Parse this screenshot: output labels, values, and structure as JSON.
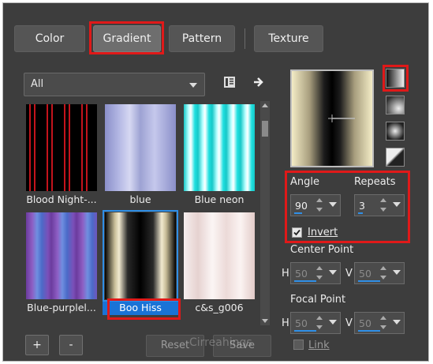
{
  "tabs": [
    {
      "label": "Color"
    },
    {
      "label": "Gradient"
    },
    {
      "label": "Pattern"
    },
    {
      "label": "Texture"
    }
  ],
  "filter": {
    "selected": "All"
  },
  "gradients": [
    {
      "label": "Blood Night-..."
    },
    {
      "label": "blue"
    },
    {
      "label": "Blue neon"
    },
    {
      "label": "Blue-purplel..."
    },
    {
      "label": "Boo Hiss"
    },
    {
      "label": "c&s_g006"
    }
  ],
  "angle": {
    "label": "Angle",
    "value": "90"
  },
  "repeats": {
    "label": "Repeats",
    "value": "3"
  },
  "invert": {
    "label": "Invert",
    "checked": true
  },
  "center_point": {
    "label": "Center Point",
    "h_label": "H",
    "h_value": "50",
    "v_label": "V",
    "v_value": "50"
  },
  "focal_point": {
    "label": "Focal Point",
    "h_label": "H",
    "h_value": "50",
    "v_label": "V",
    "v_value": "50"
  },
  "link": {
    "label": "Link",
    "checked": false
  },
  "buttons": {
    "add": "+",
    "remove": "-",
    "reset": "Reset",
    "save": "Save"
  },
  "watermark": "Cirreahings",
  "colors": {
    "highlight": "#e01919",
    "selection": "#1a73d6",
    "panel": "#3d3d3d"
  }
}
